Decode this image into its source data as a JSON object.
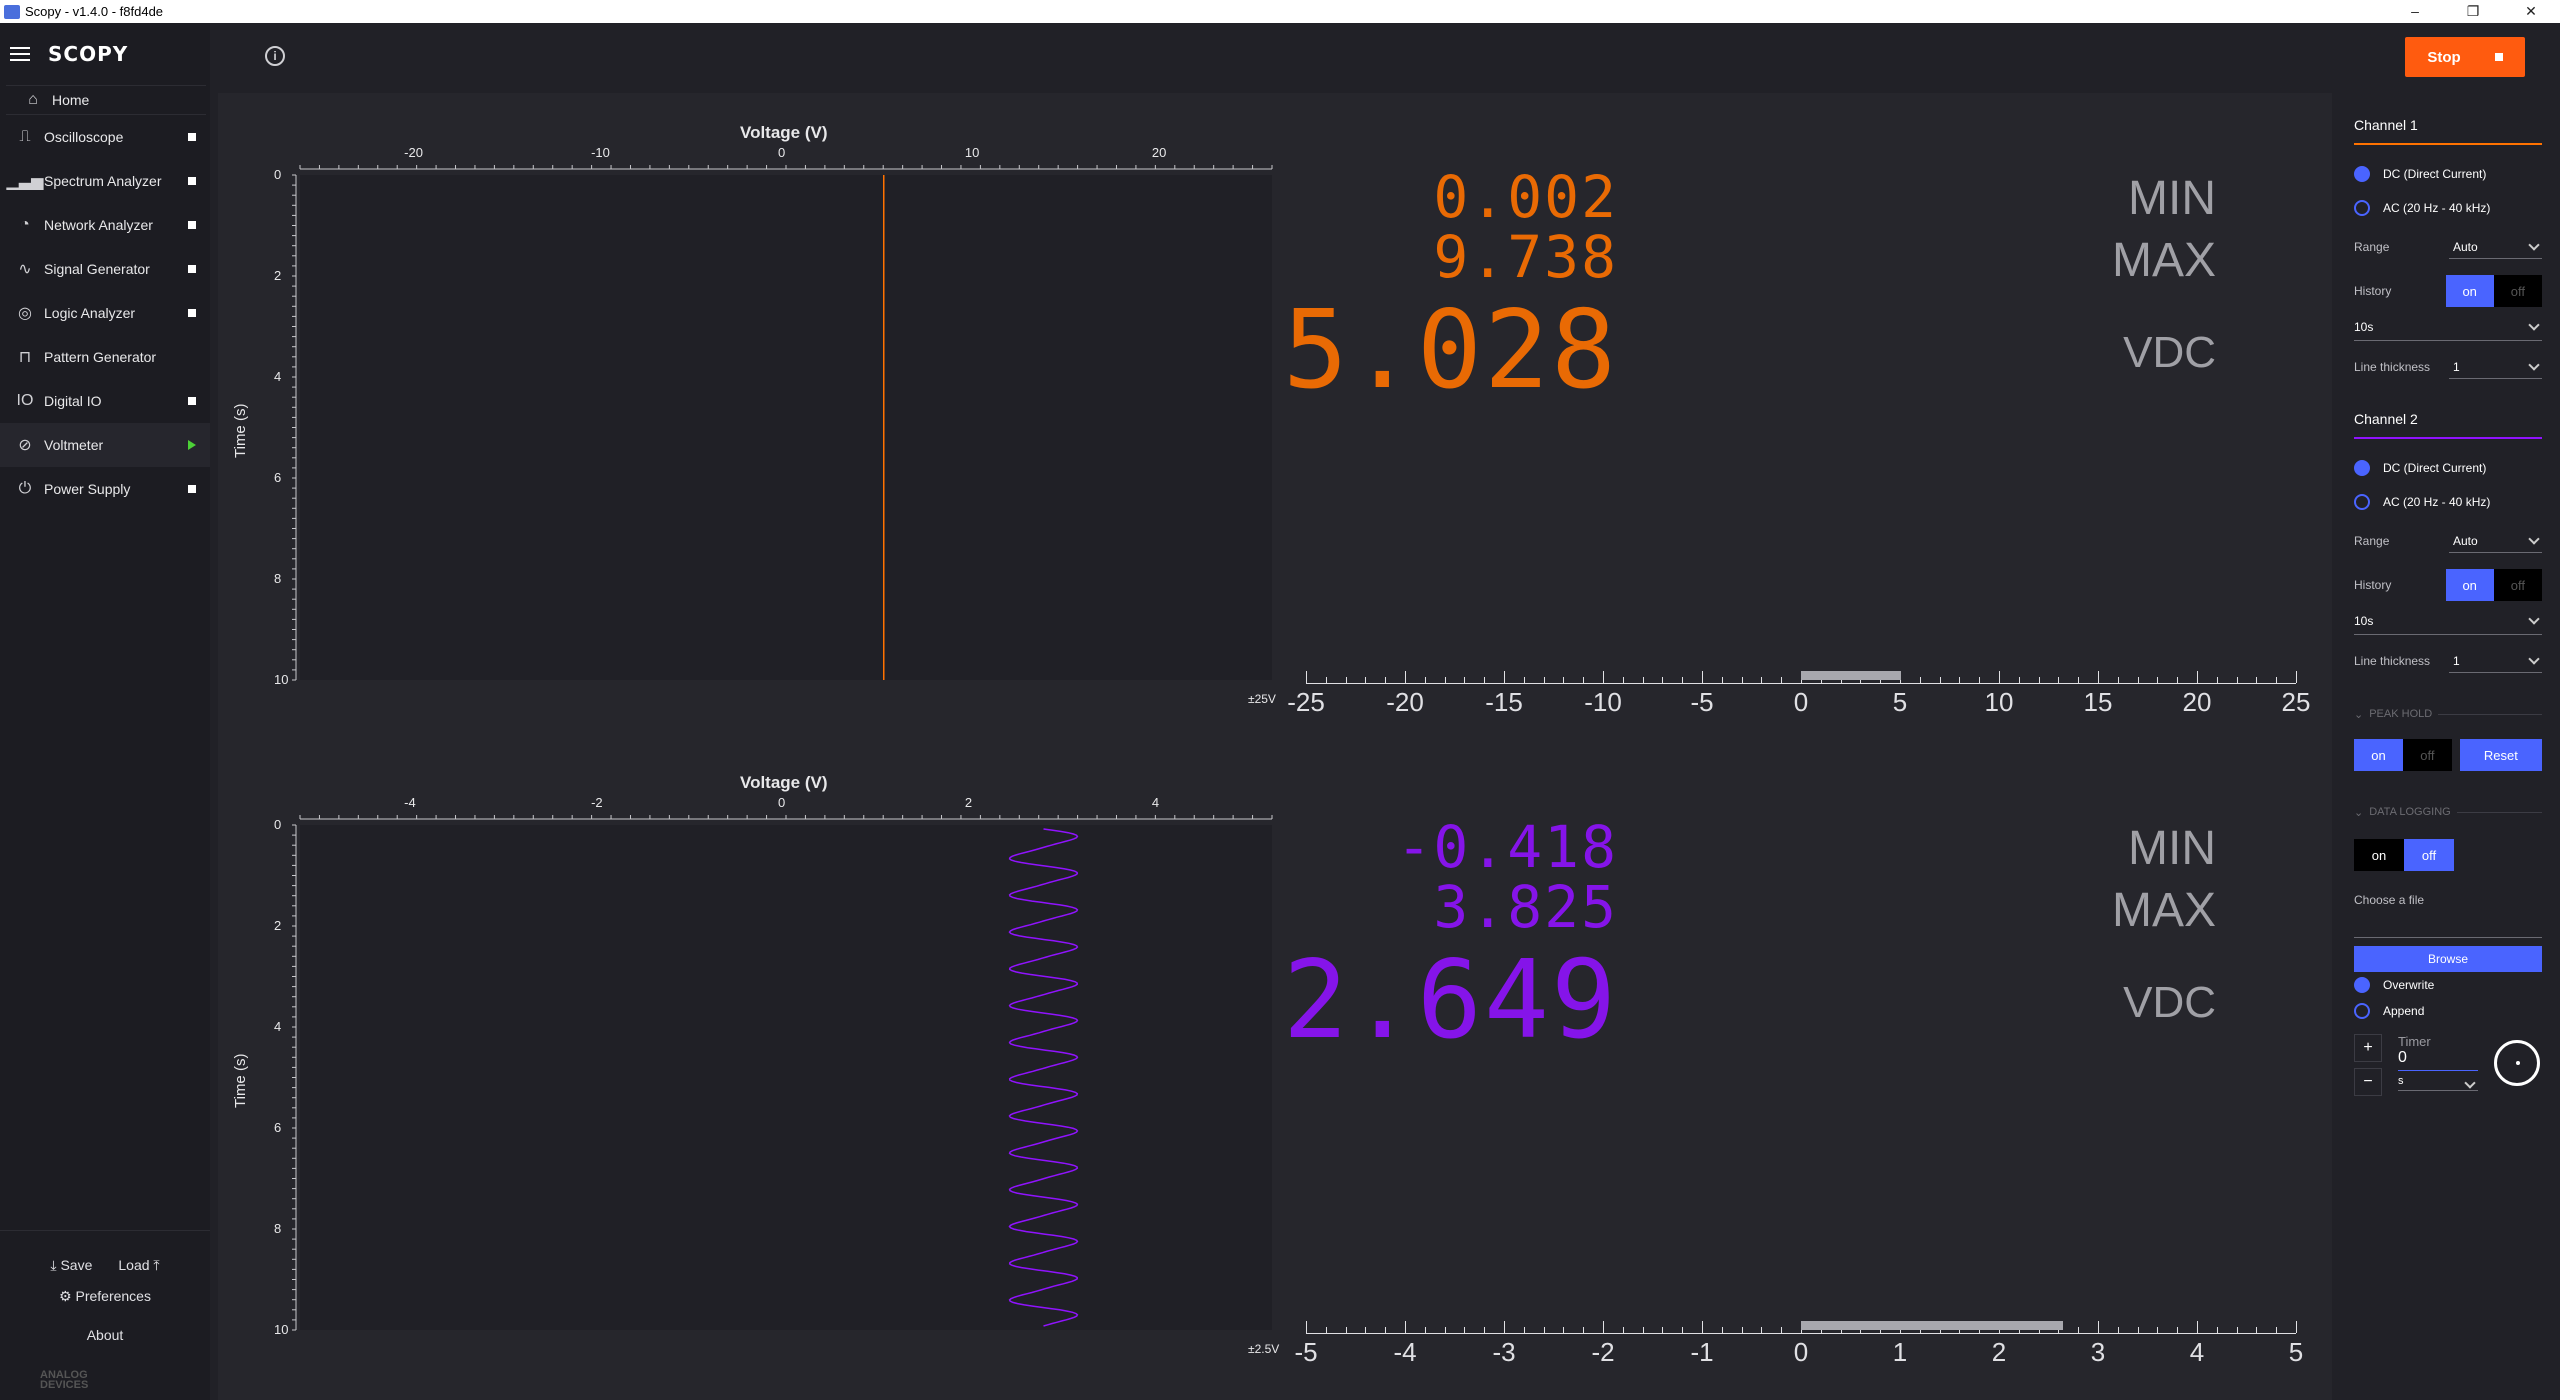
{
  "window": {
    "title": "Scopy - v1.4.0 - f8fd4de",
    "min": "–",
    "restore": "❐",
    "close": "✕"
  },
  "sidebar": {
    "logo": "SCOPY",
    "home": "Home",
    "items": [
      {
        "label": "Oscilloscope",
        "icon": "oscilloscope-icon"
      },
      {
        "label": "Spectrum Analyzer",
        "icon": "spectrum-icon"
      },
      {
        "label": "Network Analyzer",
        "icon": "network-icon"
      },
      {
        "label": "Signal Generator",
        "icon": "signal-icon"
      },
      {
        "label": "Logic Analyzer",
        "icon": "logic-icon"
      },
      {
        "label": "Pattern Generator",
        "icon": "pattern-icon"
      },
      {
        "label": "Digital IO",
        "icon": "digital-io-icon"
      },
      {
        "label": "Voltmeter",
        "icon": "voltmeter-icon"
      },
      {
        "label": "Power Supply",
        "icon": "power-icon"
      }
    ],
    "save": "Save",
    "load": "Load",
    "preferences": "Preferences",
    "about": "About",
    "brand_line1": "ANALOG",
    "brand_line2": "DEVICES"
  },
  "toolbar": {
    "stop_label": "Stop",
    "info": "i"
  },
  "plot1": {
    "title": "Voltage (V)",
    "ylabel": "Time (s)",
    "xticks": [
      "-20",
      "-10",
      "0",
      "10",
      "20"
    ],
    "yticks": [
      "0",
      "2",
      "4",
      "6",
      "8",
      "10"
    ],
    "range_label": "±25V",
    "min": "0.002",
    "max": "9.738",
    "value": "5.028",
    "min_label": "MIN",
    "max_label": "MAX",
    "unit": "VDC",
    "scale": [
      "-25",
      "-20",
      "-15",
      "-10",
      "-5",
      "0",
      "5",
      "10",
      "15",
      "20",
      "25"
    ],
    "color": "#ff7200"
  },
  "plot2": {
    "title": "Voltage (V)",
    "ylabel": "Time (s)",
    "xticks": [
      "-4",
      "-2",
      "0",
      "2",
      "4"
    ],
    "yticks": [
      "0",
      "2",
      "4",
      "6",
      "8",
      "10"
    ],
    "range_label": "±2.5V",
    "min": "-0.418",
    "max": "3.825",
    "value": "2.649",
    "min_label": "MIN",
    "max_label": "MAX",
    "unit": "VDC",
    "scale": [
      "-5",
      "-4",
      "-3",
      "-2",
      "-1",
      "0",
      "1",
      "2",
      "3",
      "4",
      "5"
    ],
    "color": "#9013fe"
  },
  "channel1": {
    "title": "Channel 1",
    "dc": "DC (Direct Current)",
    "ac": "AC (20 Hz - 40 kHz)",
    "range_label": "Range",
    "range": "Auto",
    "history_label": "History",
    "on": "on",
    "off": "off",
    "history_time": "10s",
    "thickness_label": "Line thickness",
    "thickness": "1"
  },
  "channel2": {
    "title": "Channel 2",
    "dc": "DC (Direct Current)",
    "ac": "AC (20 Hz - 40 kHz)",
    "range_label": "Range",
    "range": "Auto",
    "history_label": "History",
    "on": "on",
    "off": "off",
    "history_time": "10s",
    "thickness_label": "Line thickness",
    "thickness": "1"
  },
  "peak": {
    "title": "PEAK HOLD",
    "on": "on",
    "off": "off",
    "reset": "Reset"
  },
  "logging": {
    "title": "DATA LOGGING",
    "on": "on",
    "off": "off",
    "choose": "Choose a file",
    "browse": "Browse",
    "overwrite": "Overwrite",
    "append": "Append",
    "timer_label": "Timer",
    "timer": "0",
    "timer_unit": "s",
    "plus": "+",
    "minus": "−"
  }
}
